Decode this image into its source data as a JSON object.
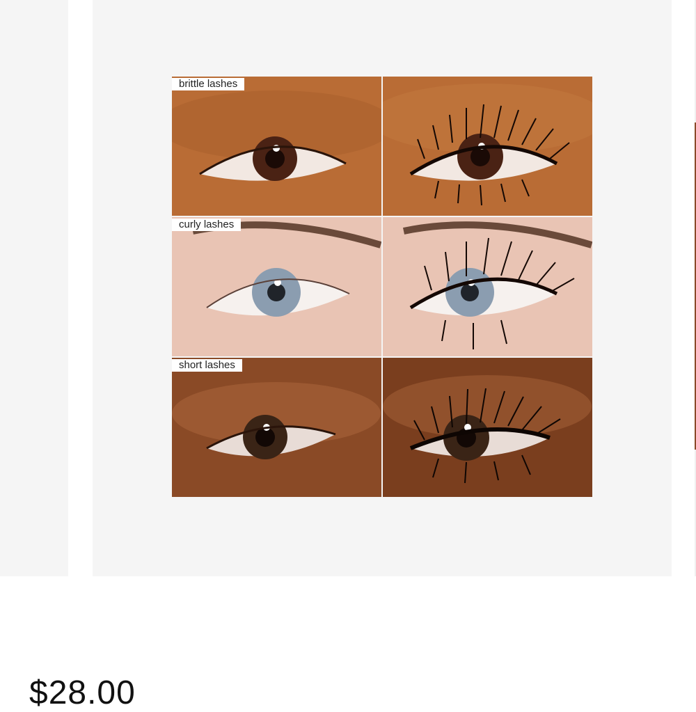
{
  "product_gallery": {
    "rows": [
      {
        "label": "brittle lashes",
        "skin": "#b96c35",
        "skin_dark": "#8c4a20",
        "iris": "#4a2214"
      },
      {
        "label": "curly lashes",
        "skin": "#e9c4b4",
        "skin_dark": "#c99886",
        "iris": "#8b9db0"
      },
      {
        "label": "short lashes",
        "skin": "#8a4a26",
        "skin_dark": "#5a2a12",
        "iris": "#3a2416"
      }
    ]
  },
  "product": {
    "price": "$28.00"
  },
  "colors": {
    "slide_bg": "#f5f5f5",
    "page_bg": "#ffffff"
  },
  "icons": [
    "eye-before-image",
    "eye-after-image"
  ]
}
